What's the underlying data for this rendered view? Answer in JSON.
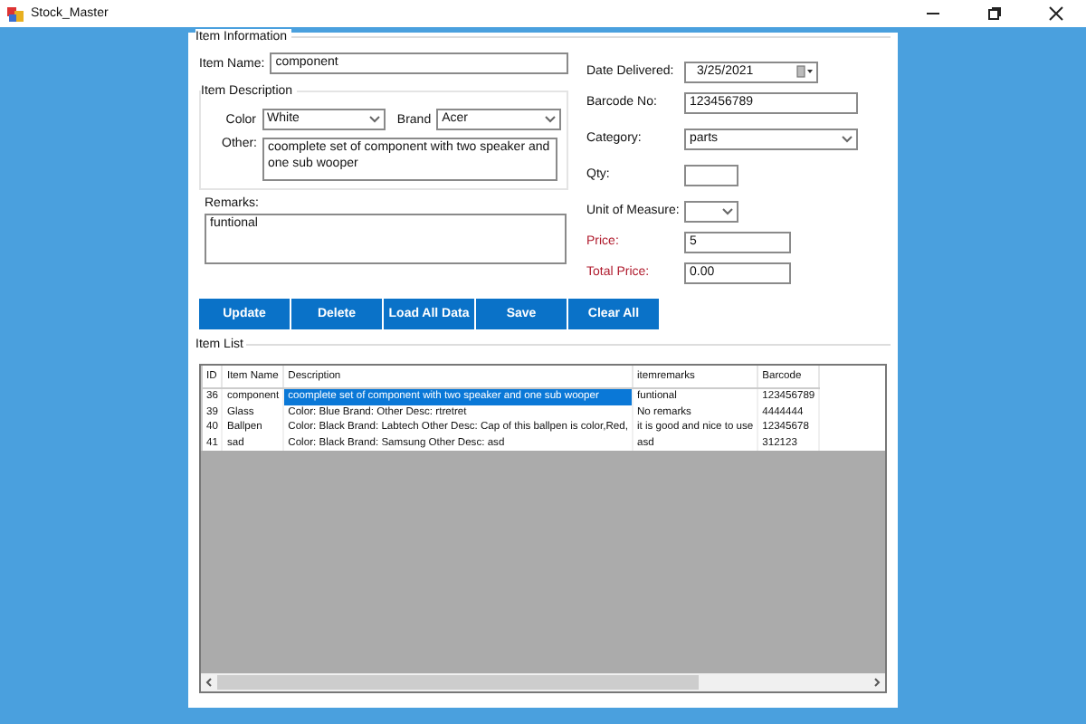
{
  "window": {
    "title": "Stock_Master"
  },
  "item_information": {
    "title": "Item Information",
    "item_name": {
      "label": "Item Name:",
      "value": "component"
    },
    "item_description": {
      "title": "Item Description",
      "color": {
        "label": "Color",
        "value": "White"
      },
      "brand": {
        "label": "Brand",
        "value": "Acer"
      },
      "other": {
        "label": "Other:",
        "value": "coomplete set of component with two speaker and one sub wooper"
      }
    },
    "remarks": {
      "label": "Remarks:",
      "value": "funtional"
    },
    "fields": [
      {
        "kind": "date",
        "label": "Date Delivered:",
        "value": "3/25/2021",
        "highlight": false
      },
      {
        "kind": "text",
        "label": "Barcode No:",
        "value": "123456789",
        "highlight": false
      },
      {
        "kind": "select",
        "label": "Category:",
        "value": "parts",
        "highlight": false
      },
      {
        "kind": "short",
        "label": "Qty:",
        "highlight": false
      },
      {
        "kind": "shortselect",
        "label": "Unit of Measure:",
        "highlight": false
      },
      {
        "kind": "medium",
        "label": "Price:",
        "value": "5",
        "highlight": true
      },
      {
        "kind": "medium",
        "label": "Total Price:",
        "value": "0.00",
        "highlight": true
      }
    ]
  },
  "buttons": [
    "Update",
    "Delete",
    "Load All Data",
    "Save",
    "Clear All"
  ],
  "item_list": {
    "title": "Item List",
    "columns": [
      "ID",
      "Item Name",
      "Description",
      "itemremarks",
      "Barcode"
    ],
    "rows": [
      {
        "selected": true,
        "cells": [
          "36",
          "component",
          "coomplete set of component with two speaker and one sub wooper",
          "funtional",
          "123456789"
        ]
      },
      {
        "selected": false,
        "cells": [
          "39",
          "Glass",
          "Color: Blue Brand:  Other Desc: rtretret",
          "No remarks",
          "4444444"
        ]
      },
      {
        "selected": false,
        "cells": [
          "40",
          "Ballpen",
          "Color: Black Brand: Labtech Other Desc: Cap of this ballpen is color,Red,",
          "it is good and nice to use",
          "12345678"
        ]
      },
      {
        "selected": false,
        "cells": [
          "41",
          "sad",
          "Color: Black Brand: Samsung Other Desc: asd",
          "asd",
          "312123"
        ]
      }
    ]
  }
}
